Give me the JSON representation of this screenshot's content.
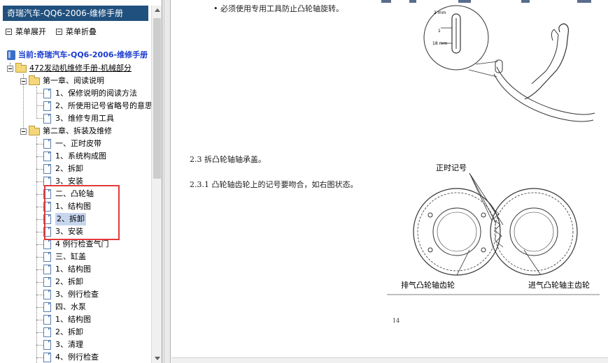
{
  "sidebar": {
    "title": "奇瑞汽车-QQ6-2006-维修手册",
    "expand_label": "菜单展开",
    "collapse_label": "菜单折叠",
    "current_label": "当前:奇瑞汽车-QQ6-2006-维修手册",
    "tree": {
      "root": "472发动机维修手册-机械部分",
      "ch1": "第一章、阅读说明",
      "ch1_items": [
        "1、保修说明的阅读方法",
        "2、所使用记号省略号的意思",
        "3、维修专用工具"
      ],
      "ch2": "第二章、拆装及维修",
      "items": [
        "一、正时皮带",
        "1、系统构成图",
        "2、拆卸",
        "3、安装",
        "二、凸轮轴",
        "1、结构图",
        "2、拆卸",
        "3、安装",
        "4 例行检查气门",
        "三、缸盖",
        "1、结构图",
        "2、拆卸",
        "3、例行检查",
        "四、水泵",
        "1、结构图",
        "2、拆卸",
        "3、清理",
        "4、例行检查"
      ],
      "selected_index": 6
    }
  },
  "content": {
    "note_line": "• 必须使用专用工具防止凸轮轴旋转。",
    "step_2_3": "2.3 拆凸轮轴轴承盖。",
    "step_2_3_1": "2.3.1 凸轮轴齿轮上的记号要吻合，如右图状态。",
    "figure1_labels": {
      "dim_top": "2 mm",
      "dim_bottom": "18 mm",
      "marker": "1"
    },
    "figure2_labels": {
      "timing_mark": "正时记号",
      "exhaust_gear": "排气凸轮轴齿轮",
      "intake_gear": "进气凸轮轴主齿轮"
    },
    "page_number": "14"
  }
}
